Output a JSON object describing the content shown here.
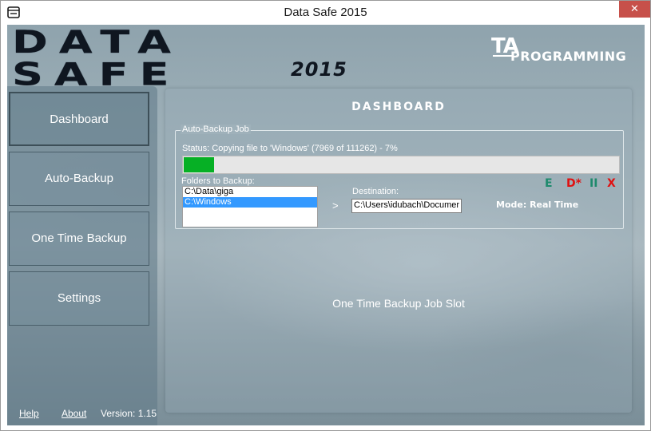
{
  "window": {
    "title": "Data Safe 2015",
    "close_glyph": "✕",
    "app_icon": "app-icon"
  },
  "logo": {
    "main": "DATA SAFE",
    "year": "2015",
    "brand_ta": "TA",
    "brand_programming": "PROGRAMMING"
  },
  "sidebar": {
    "items": [
      {
        "label": "Dashboard",
        "active": true
      },
      {
        "label": "Auto-Backup",
        "active": false
      },
      {
        "label": "One Time Backup",
        "active": false
      },
      {
        "label": "Settings",
        "active": false
      }
    ],
    "help": "Help",
    "about": "About",
    "version": "Version: 1.15"
  },
  "main": {
    "title": "DASHBOARD",
    "job": {
      "legend": "Auto-Backup Job",
      "status": "Status: Copying file to 'Windows'  (7969 of 111262)  -  7%",
      "progress": 0.07,
      "controls": [
        {
          "label": "E",
          "color": "#1e8a6c",
          "name": "edit"
        },
        {
          "label": "D*",
          "color": "#e01010",
          "name": "delete"
        },
        {
          "label": "II",
          "color": "#1e8a6c",
          "name": "pause"
        },
        {
          "label": "X",
          "color": "#e01010",
          "name": "stop"
        }
      ],
      "folders_label": "Folders to Backup:",
      "folders": [
        {
          "path": "C:\\Data\\giga",
          "selected": false
        },
        {
          "path": "C:\\Windows",
          "selected": true
        }
      ],
      "arrow": ">",
      "destination_label": "Destination:",
      "destination_value": "C:\\Users\\idubach\\Documer",
      "mode": "Mode: Real Time"
    },
    "slot_text": "One Time Backup Job Slot"
  }
}
